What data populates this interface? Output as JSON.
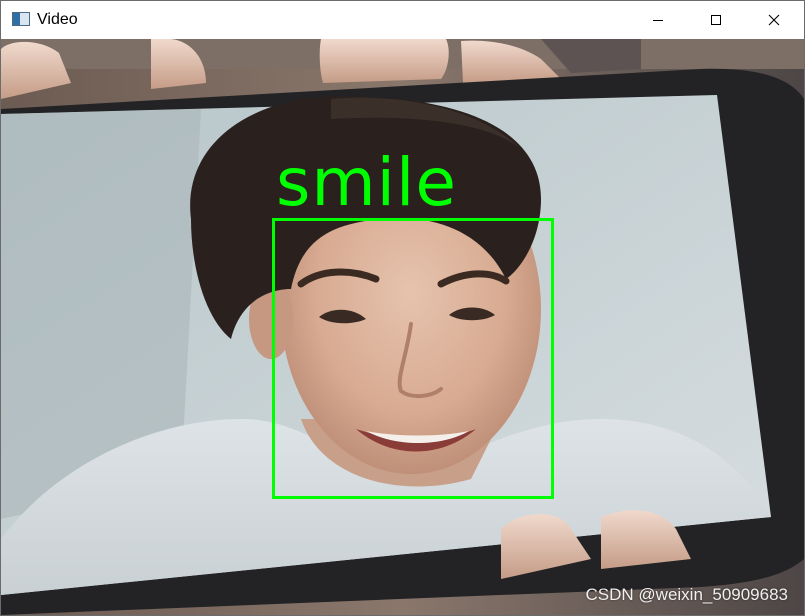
{
  "window": {
    "title": "Video"
  },
  "controls": {
    "minimize": "minimize-icon",
    "maximize": "maximize-icon",
    "close": "close-icon"
  },
  "detection": {
    "label": "smile",
    "color": "#00ff00"
  },
  "watermark": {
    "text": "CSDN @weixin_50909683"
  }
}
